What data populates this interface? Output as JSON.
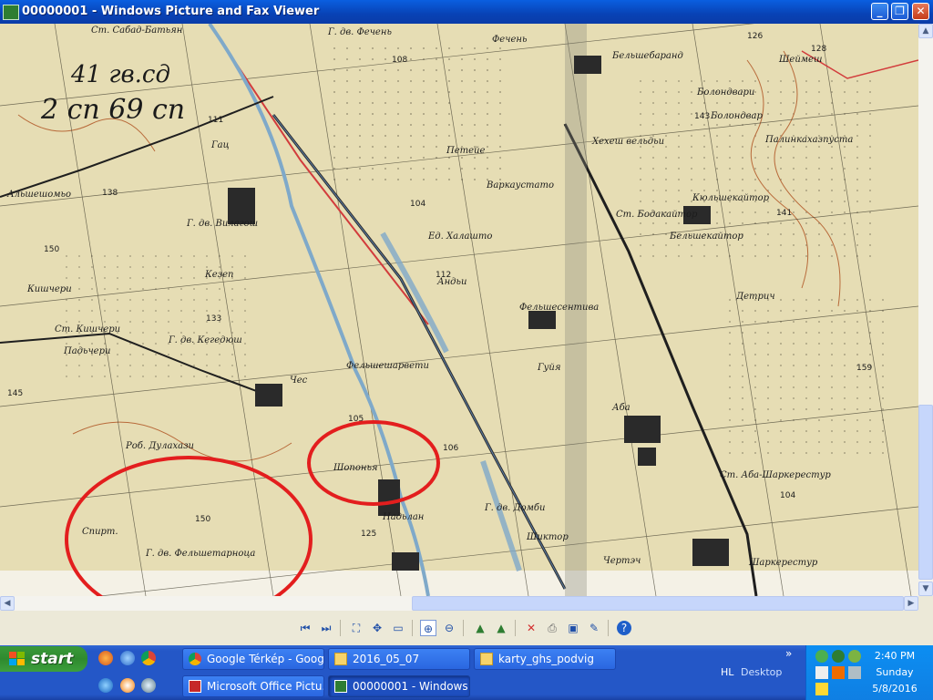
{
  "window": {
    "title": "00000001 - Windows Picture and Fax Viewer",
    "buttons": [
      "minimize",
      "maximize",
      "close"
    ]
  },
  "map": {
    "annotations": {
      "top_left_line1": "41 гв.сд",
      "top_left_line2": "2 сп 69 сп"
    },
    "places": {
      "p1": "Ст. Сабад-Батьян",
      "p2": "Г. дв. Фечень",
      "p3": "Фечень",
      "p4": "Бельшебаранд",
      "p5": "Шеймеш",
      "p6": "Болондвари",
      "p7": "Болондвар",
      "p8": "Палинкахазпуста",
      "p9": "Гац",
      "p10": "Альшешомьо",
      "p11": "Г. дв. Вилагош",
      "p12": "Петейе",
      "p13": "Варкаустато",
      "p14": "Хехеш вельдьи",
      "p15": "Кюльшекайтор",
      "p16": "Ст. Бодакайтор",
      "p17": "Бельшекайтор",
      "p18": "Ед. Халашто",
      "p19": "Андьи",
      "p20": "Кезеп",
      "p21": "Кишчери",
      "p22": "Ст. Кишчери",
      "p23": "Падьчери",
      "p24": "Г. дв. Кегедюш",
      "p25": "Чес",
      "p26": "Фельшешарвети",
      "p27": "Фельшесентива",
      "p28": "Гуйя",
      "p29": "Детрич",
      "p30": "Аба",
      "p31": "Роб. Дулахази",
      "p32": "Шопонья",
      "p33": "Спирт.",
      "p34": "Г. дв. Фельшетарноца",
      "p35": "Надьлан",
      "p36": "Г. дв. Домби",
      "p37": "Ст. Аба-Шаркерестур",
      "p38": "Шаркерестур",
      "p39": "Чертэч",
      "p40": "Шиктор"
    },
    "elevations": [
      "126",
      "128",
      "108",
      "143",
      "141",
      "111",
      "138",
      "104",
      "112",
      "150",
      "133",
      "145",
      "105",
      "106",
      "159",
      "125",
      "104",
      "150"
    ],
    "colors": {
      "paper": "#E6DDB4",
      "grid": "#2a2a2a",
      "water": "#7fa9c9",
      "circle": "#E31E1E",
      "roads": "#c83a3a"
    }
  },
  "toolbar": {
    "icons": [
      "previous-image-icon",
      "next-image-icon",
      "best-fit-icon",
      "actual-size-icon",
      "slideshow-icon",
      "zoom-in-icon",
      "zoom-out-icon",
      "rotate-clockwise-icon",
      "rotate-counterclockwise-icon",
      "delete-icon",
      "print-icon",
      "save-icon",
      "open-for-editing-icon",
      "help-icon"
    ]
  },
  "taskbar": {
    "start_label": "start",
    "tasks_row1": [
      {
        "label": "Google Térkép - Goog...",
        "icon": "chrome-icon"
      },
      {
        "label": "2016_05_07",
        "icon": "folder-icon"
      },
      {
        "label": "karty_ghs_podvig",
        "icon": "folder-icon"
      }
    ],
    "tasks_row2": [
      {
        "label": "Microsoft Office Pictu...",
        "icon": "office-picture-icon"
      },
      {
        "label": "00000001 - Windows ...",
        "icon": "picture-viewer-icon",
        "active": true
      }
    ],
    "lang": "HL",
    "desktop_label": "Desktop",
    "chevron": "»",
    "clock": {
      "time": "2:40 PM",
      "day": "Sunday",
      "date": "5/8/2016"
    }
  }
}
